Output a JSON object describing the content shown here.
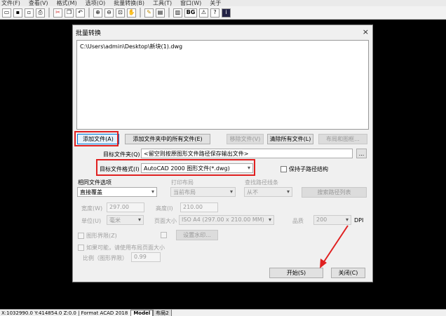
{
  "menubar": [
    "文件(F)",
    "查看(V)",
    "格式(M)",
    "选项(O)",
    "批量转换(B)",
    "工具(T)",
    "窗口(W)",
    "关于"
  ],
  "toolbar_icons": [
    "folder-open-icon",
    "save-icon",
    "save-as-icon",
    "print-icon",
    "cut-icon",
    "copy-icon",
    "undo-icon",
    "zoom-in-icon",
    "zoom-out-icon",
    "zoom-window-icon",
    "pan-icon",
    "layer-icon",
    "print-icon-2",
    "bg-icon",
    "warning-icon",
    "help-icon",
    "info-icon"
  ],
  "toolbar_bg_label": "BG",
  "dialog": {
    "title": "批量转换",
    "close": "×",
    "file_list": [
      "C:\\Users\\admin\\Desktop\\新块(1).dwg"
    ],
    "add_file_button": "添加文件(A)",
    "add_folder_button": "添加文件夹中的所有文件(E)",
    "remove_file_button": "移除文件(V)",
    "clear_files_button": "清除所有文件(L)",
    "layout_button": "布局和图框...",
    "target_folder_label": "目标文件夹(Q)",
    "target_folder_placeholder": "<留空则按原图形文件路径保存输出文件>",
    "browse_button": "...",
    "target_format_label": "目标文件格式(I)",
    "target_format_value": "AutoCAD 2000 图形文件(*.dwg)",
    "keep_path_label": "保持子路径结构",
    "same_file_label": "相同文件选项",
    "same_file_value": "直接覆盖",
    "print_layout_label": "打印布局",
    "print_layout_value": "当前布局",
    "find_path_label": "查找路径线条",
    "find_path_value": "从不",
    "search_paths_button": "搜索路径列表",
    "width_label": "宽度(W)",
    "width_value": "297.00",
    "height_label": "高度(I)",
    "height_value": "210.00",
    "unit_label": "单位(U)",
    "unit_value": "毫米",
    "page_size_label": "页面大小",
    "page_size_value": "ISO A4 (297.00 x 210.00 MM)",
    "quality_label": "品质",
    "quality_value": "200",
    "dpi_label": "DPI",
    "drawing_bounds_label": "图形界限(Z)",
    "watermark_button": "设置水印...",
    "use_layout_label": "如果可能，请使用布局页面大小",
    "scale_label": "比例（图形界限）",
    "scale_value": "0.99",
    "start_button": "开始(S)",
    "close_button": "关闭(C)"
  },
  "statusbar": {
    "coords": "X:1032990.0 Y:414854.0 Z:0.0 | Format ACAD 2018",
    "model_tab": "Model",
    "layout_tab": "布局2"
  },
  "colors": {
    "highlight_frame": "#e02020",
    "arrow": "#e02020"
  }
}
